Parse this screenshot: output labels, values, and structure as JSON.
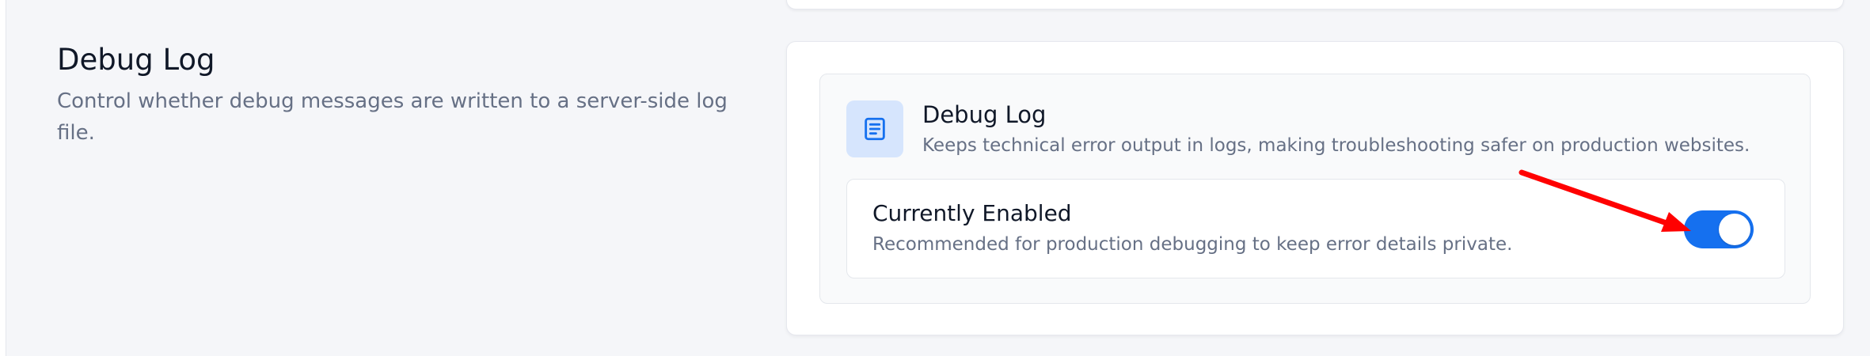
{
  "section": {
    "title": "Debug Log",
    "description": "Control whether debug messages are written to a server-side log file."
  },
  "feature": {
    "icon": "log-file-icon",
    "title": "Debug Log",
    "description": "Keeps technical error output in logs, making troubleshooting safer on production websites."
  },
  "status": {
    "title": "Currently Enabled",
    "description": "Recommended for production debugging to keep error details private.",
    "enabled": true
  },
  "colors": {
    "accent": "#1570ef",
    "icon_bg": "#d6e5fd",
    "annotation_arrow": "#ff0000"
  }
}
